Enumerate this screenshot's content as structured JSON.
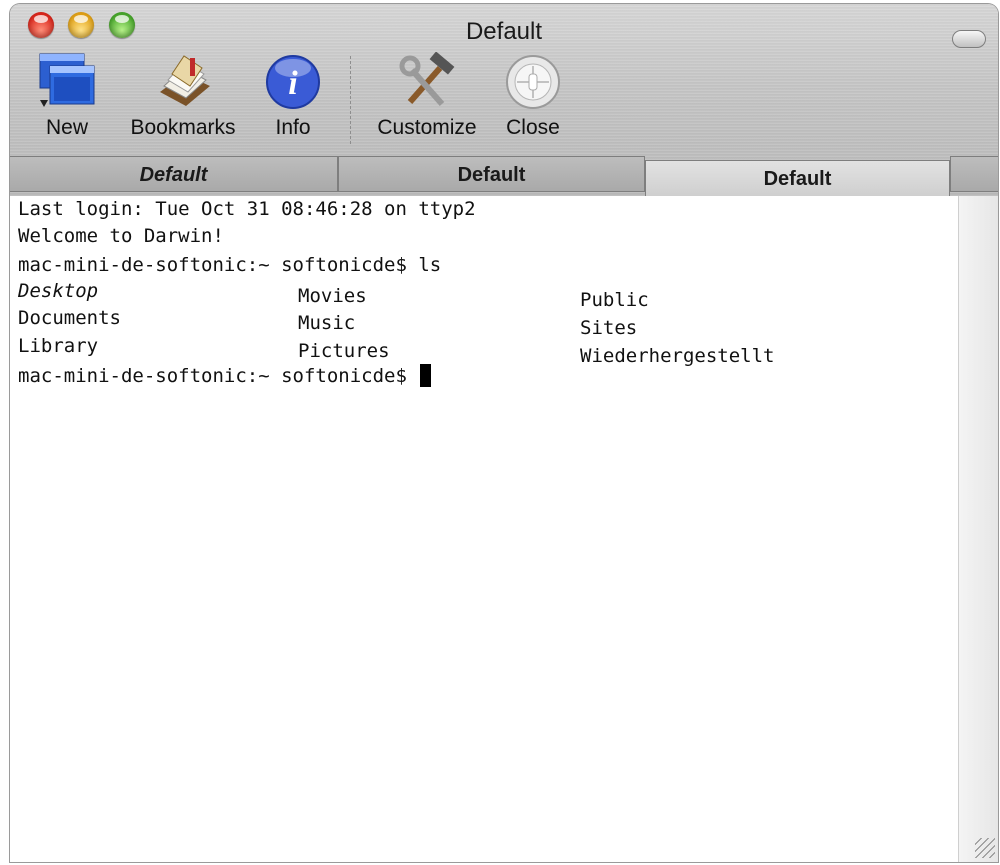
{
  "window": {
    "title": "Default"
  },
  "toolbar": {
    "new_label": "New",
    "bookmarks_label": "Bookmarks",
    "info_label": "Info",
    "customize_label": "Customize",
    "close_label": "Close"
  },
  "tabs": [
    {
      "label": "Default"
    },
    {
      "label": "Default"
    },
    {
      "label": "Default"
    }
  ],
  "terminal": {
    "lines": [
      "Last login: Tue Oct 31 08:46:28 on ttyp2",
      "Welcome to Darwin!",
      "mac-mini-de-softonic:~ softonicde$ ls"
    ],
    "listing": {
      "col1": [
        "Desktop",
        "Documents",
        "Library"
      ],
      "col2": [
        "Movies",
        "Music",
        "Pictures"
      ],
      "col3": [
        "Public",
        "Sites",
        "Wiederhergestellt"
      ]
    },
    "prompt": "mac-mini-de-softonic:~ softonicde$ "
  },
  "colors": {
    "accent_info": "#3a5bd6",
    "terminal_bg": "#ffffff"
  }
}
